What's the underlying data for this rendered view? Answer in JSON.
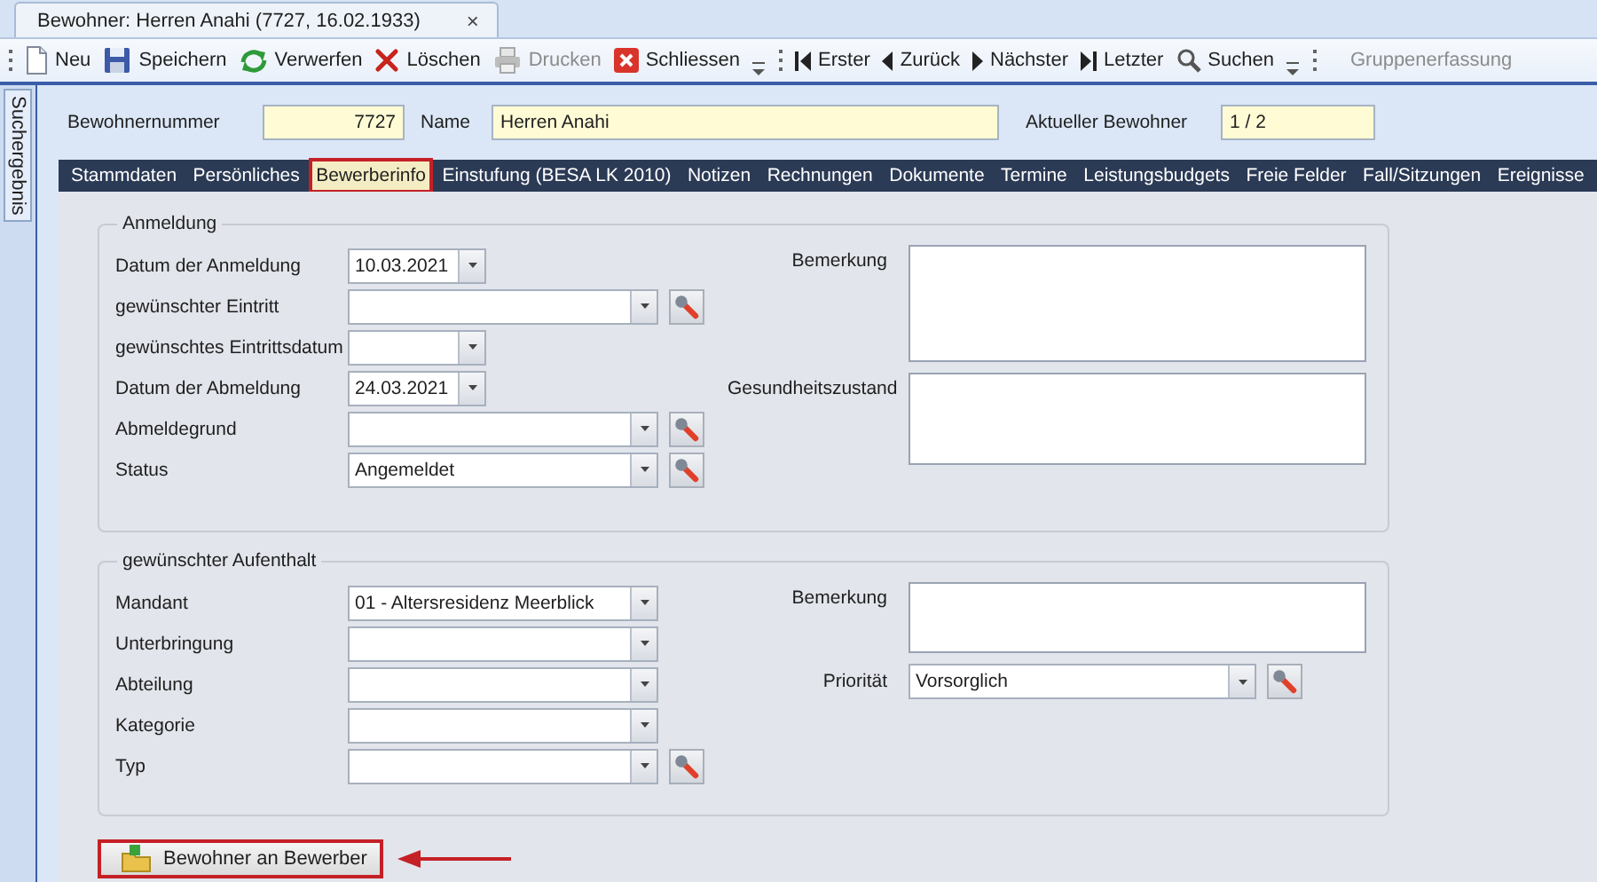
{
  "document_tab": {
    "title": "Bewohner: Herren Anahi (7727, 16.02.1933)",
    "close": "×"
  },
  "toolbar": [
    {
      "kind": "grip"
    },
    {
      "kind": "button",
      "label": "Neu",
      "disabled": false
    },
    {
      "kind": "button",
      "label": "Speichern",
      "disabled": false
    },
    {
      "kind": "button",
      "label": "Verwerfen",
      "disabled": false
    },
    {
      "kind": "button",
      "label": "Löschen",
      "disabled": false
    },
    {
      "kind": "button",
      "label": "Drucken",
      "disabled": true
    },
    {
      "kind": "button",
      "label": "Schliessen",
      "disabled": false
    },
    {
      "kind": "overflow"
    },
    {
      "kind": "grip"
    },
    {
      "kind": "button",
      "label": "Erster",
      "disabled": false
    },
    {
      "kind": "button",
      "label": "Zurück",
      "disabled": false
    },
    {
      "kind": "button",
      "label": "Nächster",
      "disabled": false
    },
    {
      "kind": "button",
      "label": "Letzter",
      "disabled": false
    },
    {
      "kind": "button",
      "label": "Suchen",
      "disabled": false
    },
    {
      "kind": "overflow"
    },
    {
      "kind": "grip"
    },
    {
      "kind": "button",
      "label": "Gruppenerfassung",
      "disabled": true
    }
  ],
  "side_tab": {
    "label": "Suchergebnis"
  },
  "header": [
    {
      "label": "Bewohnernummer",
      "value": "7727",
      "kind": "number"
    },
    {
      "label": "Name",
      "value": "Herren Anahi",
      "kind": "text"
    },
    {
      "label": "Aktueller Bewohner",
      "value": "1 / 2",
      "kind": "text"
    }
  ],
  "nav_tabs": [
    {
      "label": "Stammdaten",
      "selected": false,
      "highlighted": false
    },
    {
      "label": "Persönliches",
      "selected": false,
      "highlighted": false
    },
    {
      "label": "Bewerberinfo",
      "selected": true,
      "highlighted": true
    },
    {
      "label": "Einstufung (BESA LK 2010)",
      "selected": false,
      "highlighted": false
    },
    {
      "label": "Notizen",
      "selected": false,
      "highlighted": false
    },
    {
      "label": "Rechnungen",
      "selected": false,
      "highlighted": false
    },
    {
      "label": "Dokumente",
      "selected": false,
      "highlighted": false
    },
    {
      "label": "Termine",
      "selected": false,
      "highlighted": false
    },
    {
      "label": "Leistungsbudgets",
      "selected": false,
      "highlighted": false
    },
    {
      "label": "Freie Felder",
      "selected": false,
      "highlighted": false
    },
    {
      "label": "Fall/Sitzungen",
      "selected": false,
      "highlighted": false
    },
    {
      "label": "Ereignisse",
      "selected": false,
      "highlighted": false
    }
  ],
  "groups": [
    {
      "title": "Anmeldung",
      "left": [
        {
          "label": "Datum der Anmeldung",
          "kind": "date",
          "value": "10.03.2021",
          "lookup": false
        },
        {
          "label": "gewünschter Eintritt",
          "kind": "combo",
          "lookup": true
        },
        {
          "label": "gewünschtes Eintrittsdatum",
          "kind": "date",
          "lookup": false
        },
        {
          "label": "Datum der Abmeldung",
          "kind": "date",
          "value": "24.03.2021",
          "lookup": false
        },
        {
          "label": "Abmeldegrund",
          "kind": "combo",
          "lookup": true
        },
        {
          "label": "Status",
          "kind": "combo",
          "value": "Angemeldet",
          "lookup": true
        }
      ],
      "right": [
        {
          "label": "Bemerkung",
          "kind": "memo",
          "lookup": false
        },
        {
          "label": "Gesundheitszustand",
          "kind": "memo",
          "lookup": false
        }
      ]
    },
    {
      "title": "gewünschter Aufenthalt",
      "left": [
        {
          "label": "Mandant",
          "kind": "combo",
          "value": "01 - Altersresidenz Meerblick",
          "lookup": false
        },
        {
          "label": "Unterbringung",
          "kind": "combo",
          "lookup": false
        },
        {
          "label": "Abteilung",
          "kind": "combo",
          "lookup": false
        },
        {
          "label": "Kategorie",
          "kind": "combo",
          "lookup": false
        },
        {
          "label": "Typ",
          "kind": "combo",
          "lookup": true
        }
      ],
      "right": [
        {
          "label": "Bemerkung",
          "kind": "memo",
          "lookup": false
        },
        {
          "label": "Priorität",
          "kind": "combo",
          "value": "Vorsorglich",
          "lookup": true
        }
      ]
    }
  ],
  "action_button": {
    "label": "Bewohner an Bewerber",
    "highlighted": true
  }
}
